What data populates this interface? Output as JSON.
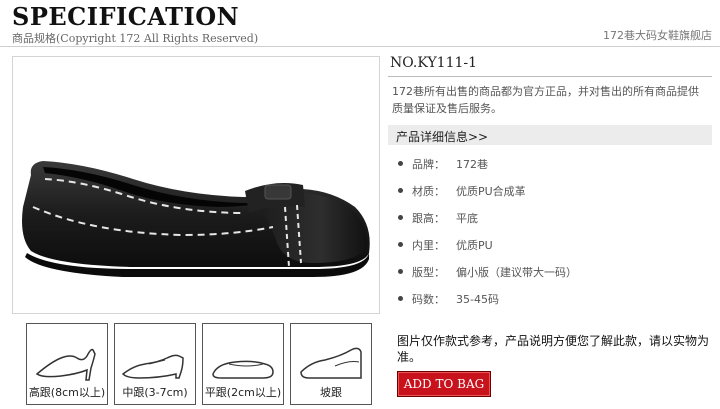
{
  "header": {
    "title": "SPECIFICATION",
    "subtitle": "商品规格(Copyright 172 All Rights Reserved)",
    "store": "172巷大码女鞋旗舰店"
  },
  "product": {
    "model": "NO.KY111-1",
    "description": "172巷所有出售的商品都为官方正品，并对售出的所有商品提供质量保证及售后服务。",
    "details_heading": "产品详细信息>>",
    "specs": [
      {
        "key": "品牌：",
        "value": "172巷"
      },
      {
        "key": "材质：",
        "value": "优质PU合成革"
      },
      {
        "key": "跟高：",
        "value": "平底"
      },
      {
        "key": "内里：",
        "value": "优质PU"
      },
      {
        "key": "版型：",
        "value": "偏小版（建议带大一码）"
      },
      {
        "key": "码数：",
        "value": "35-45码"
      }
    ],
    "note": "图片仅作款式参考，产品说明方便您了解此款，请以实物为准。",
    "add_to_bag": "ADD TO BAG"
  },
  "heel_types": [
    {
      "label": "高跟(8cm以上)",
      "icon": "high-heel-icon"
    },
    {
      "label": "中跟(3-7cm)",
      "icon": "mid-heel-icon"
    },
    {
      "label": "平跟(2cm以上)",
      "icon": "flat-heel-icon"
    },
    {
      "label": "坡跟",
      "icon": "wedge-heel-icon"
    }
  ],
  "colors": {
    "button": "#c8121c",
    "rule": "#cfcfcf",
    "detail_bar": "#ececec"
  }
}
